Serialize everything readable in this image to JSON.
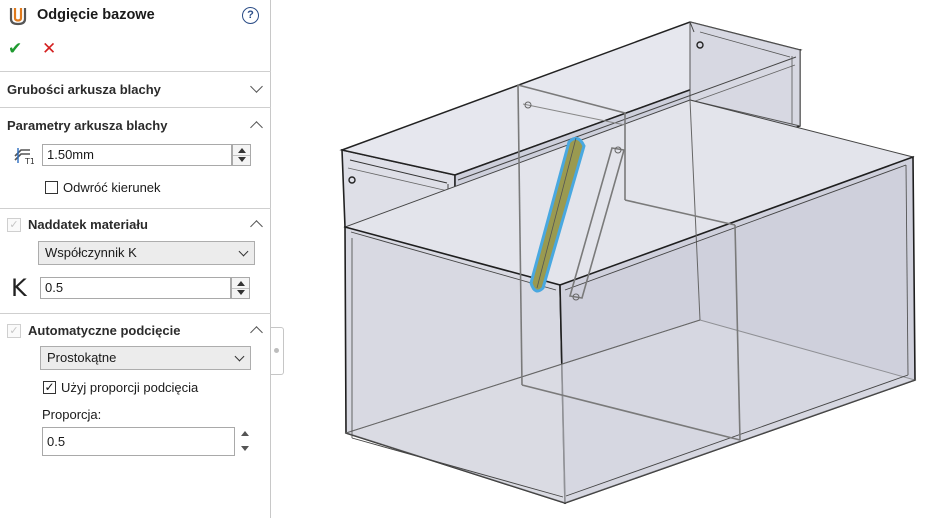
{
  "panel": {
    "title": "Odgięcie bazowe",
    "help_glyph": "?",
    "ok_glyph": "✔",
    "cancel_glyph": "✕",
    "sections": {
      "thickness": {
        "label": "Grubości arkusza blachy",
        "expanded": false
      },
      "params": {
        "label": "Parametry arkusza blachy",
        "expanded": true,
        "thickness_value": "1.50mm",
        "reverse_direction_label": "Odwróć kierunek",
        "reverse_direction_checked": false
      },
      "allowance": {
        "label": "Naddatek materiału",
        "expanded": true,
        "type_value": "Współczynnik K",
        "k_symbol": "K",
        "k_value": "0.5"
      },
      "relief": {
        "label": "Automatyczne podcięcie",
        "expanded": true,
        "type_value": "Prostokątne",
        "use_ratio_label": "Użyj proporcji podcięcia",
        "use_ratio_checked": true,
        "ratio_label": "Proporcja:",
        "ratio_value": "0.5"
      }
    }
  },
  "icons": {
    "feature": "base-flange-icon",
    "thickness": "sheet-thickness-icon",
    "chevron_collapsed": "chevron-down-icon",
    "chevron_expanded": "chevron-up-icon"
  },
  "colors": {
    "ok": "#1f9a30",
    "cancel": "#d42020",
    "highlight_edge": "#49a8e0",
    "highlight_fill": "#9a9a50",
    "model_edge": "#1f1f1f",
    "model_face": "#dcdde6"
  }
}
